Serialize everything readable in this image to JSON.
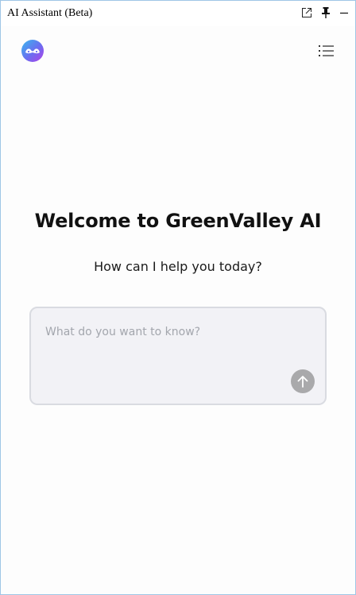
{
  "window": {
    "title": "AI Assistant (Beta)",
    "controls": [
      "popout-icon",
      "pin-icon",
      "minimize-icon"
    ]
  },
  "header": {
    "logo_icon": "assistant-logo-icon",
    "menu_icon": "list-menu-icon"
  },
  "main": {
    "welcome": "Welcome to GreenValley AI",
    "subtitle": "How can I help you today?"
  },
  "prompt": {
    "placeholder": "What do you want to know?",
    "value": "",
    "send_icon": "arrow-up-icon"
  },
  "colors": {
    "logo_gradient": [
      "#39b9ee",
      "#6b6df0",
      "#b040e8"
    ],
    "prompt_bg": "#f2f2f6",
    "prompt_border": "#d9dbe1",
    "send_button": "#a9a9ab",
    "window_border": "#9fc6e6"
  }
}
